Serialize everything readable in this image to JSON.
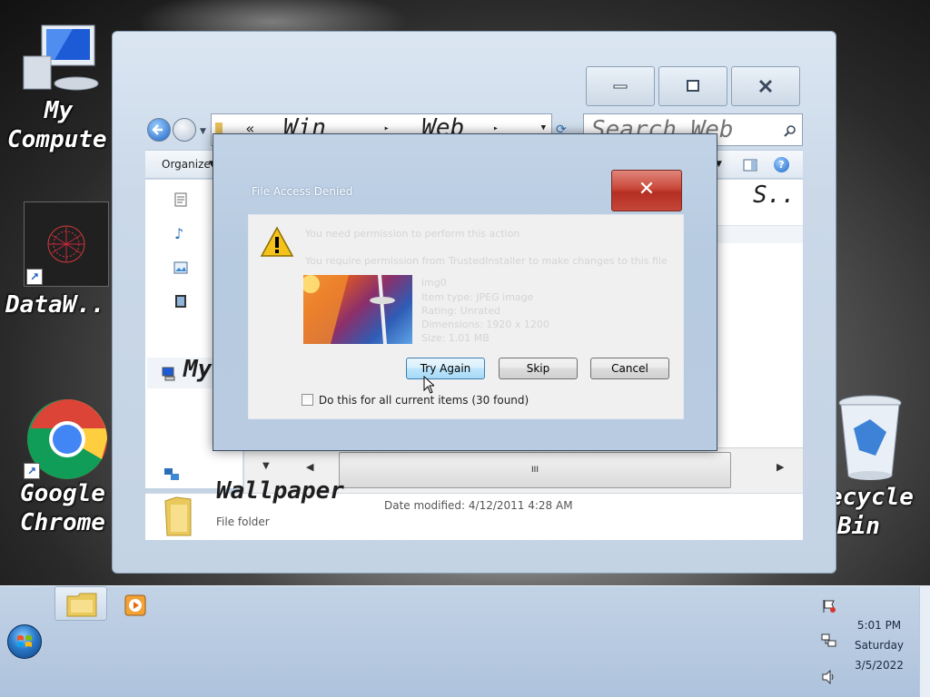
{
  "desktop": {
    "icons": [
      {
        "label_1": "My",
        "label_2": "Compute"
      },
      {
        "label_1": "DataW.."
      },
      {
        "label_1": "Google",
        "label_2": "Chrome"
      },
      {
        "label_1": "ecycle",
        "label_2": "Bin"
      }
    ]
  },
  "explorer": {
    "address": {
      "sep": "«",
      "part1": "Win",
      "part2": "Web"
    },
    "search_placeholder": "Search Web",
    "toolbar": {
      "organize": "Organize"
    },
    "right_column_header": "S..",
    "nav_item": "My",
    "scroll_thumb": "III",
    "details": {
      "name": "Wallpaper",
      "type": "File folder",
      "date_modified": "Date modified: 4/12/2011 4:28 AM"
    }
  },
  "dialog": {
    "title": "File Access Denied",
    "close_label": "✕",
    "faded_lines": [
      "You need permission to perform this action",
      "You require permission from TrustedInstaller to make changes to this file",
      "img0",
      "Item type: JPEG image",
      "Rating: Unrated",
      "Dimensions: 1920 x 1200",
      "Size: 1.01 MB"
    ],
    "buttons": {
      "try_again": "Try Again",
      "skip": "Skip",
      "cancel": "Cancel"
    },
    "checkbox_label": "Do this for all current items (30 found)"
  },
  "taskbar": {
    "clock": {
      "time": "5:01 PM",
      "day": "Saturday",
      "date": "3/5/2022"
    }
  }
}
